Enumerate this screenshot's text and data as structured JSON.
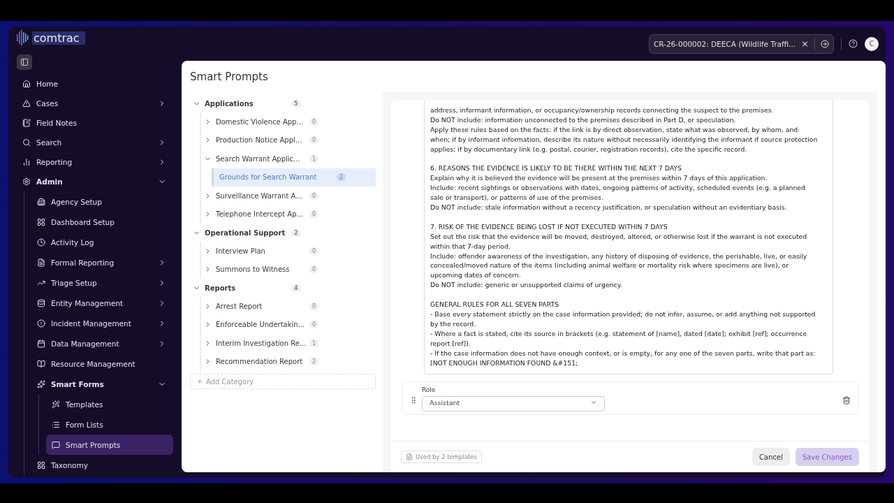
{
  "app": {
    "logo": "comtrac"
  },
  "case_tab": {
    "title": "CR-26-000002: DEECA (Wildlife Traffi...",
    "close": "×"
  },
  "avatar": {
    "initial": "C"
  },
  "nav": [
    {
      "label": "Home",
      "expandable": false,
      "expanded": false,
      "selected": false
    },
    {
      "label": "Cases",
      "expandable": true,
      "expanded": false,
      "selected": false
    },
    {
      "label": "Field Notes",
      "expandable": false,
      "expanded": false,
      "selected": false
    },
    {
      "label": "Search",
      "expandable": true,
      "expanded": false,
      "selected": false
    },
    {
      "label": "Reporting",
      "expandable": true,
      "expanded": false,
      "selected": false
    },
    {
      "label": "Admin",
      "expandable": true,
      "expanded": true,
      "selected": false,
      "children": [
        {
          "label": "Agency Setup",
          "expandable": false,
          "expanded": false,
          "selected": false
        },
        {
          "label": "Dashboard Setup",
          "expandable": false,
          "expanded": false,
          "selected": false
        },
        {
          "label": "Activity Log",
          "expandable": false,
          "expanded": false,
          "selected": false
        },
        {
          "label": "Formal Reporting",
          "expandable": true,
          "expanded": false,
          "selected": false
        },
        {
          "label": "Triage Setup",
          "expandable": true,
          "expanded": false,
          "selected": false
        },
        {
          "label": "Entity Management",
          "expandable": true,
          "expanded": false,
          "selected": false
        },
        {
          "label": "Incident Management",
          "expandable": true,
          "expanded": false,
          "selected": false
        },
        {
          "label": "Data Management",
          "expandable": true,
          "expanded": false,
          "selected": false
        },
        {
          "label": "Resource Management",
          "expandable": false,
          "expanded": false,
          "selected": false
        },
        {
          "label": "Smart Forms",
          "expandable": true,
          "expanded": true,
          "selected": false,
          "children": [
            {
              "label": "Templates",
              "expandable": false,
              "expanded": false,
              "selected": false
            },
            {
              "label": "Form Lists",
              "expandable": false,
              "expanded": false,
              "selected": false
            },
            {
              "label": "Smart Prompts",
              "expandable": false,
              "expanded": false,
              "selected": true
            }
          ]
        },
        {
          "label": "Taxonomy",
          "expandable": false,
          "expanded": false,
          "selected": false
        }
      ]
    }
  ],
  "page": {
    "title": "Smart Prompts"
  },
  "tree": [
    {
      "label": "Applications",
      "count": "5",
      "expanded": true,
      "selected": false,
      "children": [
        {
          "label": "Domestic Violence App...",
          "count": "0",
          "expanded": false,
          "selected": false
        },
        {
          "label": "Production Notice Appl...",
          "count": "0",
          "expanded": false,
          "selected": false
        },
        {
          "label": "Search Warrant Applic...",
          "count": "1",
          "expanded": true,
          "selected": false,
          "children": [
            {
              "label": "Grounds for Search Warrant",
              "count": "2",
              "expanded": false,
              "selected": true
            }
          ]
        },
        {
          "label": "Surveillance Warrant A...",
          "count": "0",
          "expanded": false,
          "selected": false
        },
        {
          "label": "Telephone Intercept Ap...",
          "count": "0",
          "expanded": false,
          "selected": false
        }
      ]
    },
    {
      "label": "Operational Support",
      "count": "2",
      "expanded": true,
      "selected": false,
      "children": [
        {
          "label": "Interview Plan",
          "count": "0",
          "expanded": false,
          "selected": false
        },
        {
          "label": "Summons to Witness",
          "count": "0",
          "expanded": false,
          "selected": false
        }
      ]
    },
    {
      "label": "Reports",
      "count": "4",
      "expanded": true,
      "selected": false,
      "children": [
        {
          "label": "Arrest Report",
          "count": "0",
          "expanded": false,
          "selected": false
        },
        {
          "label": "Enforceable Undertakin...",
          "count": "0",
          "expanded": false,
          "selected": false
        },
        {
          "label": "Interim Investigation Re...",
          "count": "1",
          "expanded": false,
          "selected": false
        },
        {
          "label": "Recommendation Report",
          "count": "2",
          "expanded": false,
          "selected": false
        }
      ]
    }
  ],
  "add_category": "Add Category",
  "prompt": {
    "sections": [
      {
        "lines": [
          "address, informant information, or occupancy/ownership records connecting the suspect to the premises.",
          "Do NOT include: information unconnected to the premises described in Part D, or speculation.",
          "Apply these rules based on the facts: if the link is by direct observation, state what was observed, by whom, and",
          "when; if by informant information, describe its nature without necessarily identifying the informant if source protection",
          "applies; if by documentary link (e.g. postal, courier, registration records), cite the specific record."
        ]
      },
      {
        "lines": [
          "6. REASONS THE EVIDENCE IS LIKELY TO BE THERE WITHIN THE NEXT 7 DAYS",
          "Explain why it is believed the evidence will be present at the premises within 7 days of this application.",
          "Include: recent sightings or observations with dates, ongoing patterns of activity, scheduled events (e.g. a planned",
          "sale or transport), or patterns of use of the premises.",
          "Do NOT include: stale information without a recency justification, or speculation without an evidentiary basis."
        ]
      },
      {
        "lines": [
          "7. RISK OF THE EVIDENCE BEING LOST IF NOT EXECUTED WITHIN 7 DAYS",
          "Set out the risk that the evidence will be moved, destroyed, altered, or otherwise lost if the warrant is not executed",
          "within that 7-day period.",
          "Include: offender awareness of the investigation, any history of disposing of evidence, the perishable, live, or easily",
          "concealed/moved nature of the items (including animal welfare or mortality risk where specimens are live), or",
          "upcoming dates of concern.",
          "Do NOT include: generic or unsupported claims of urgency."
        ]
      },
      {
        "lines": [
          "GENERAL RULES FOR ALL SEVEN PARTS",
          "- Base every statement strictly on the case information provided; do not infer, assume, or add anything not supported",
          "by the record.",
          "- Where a fact is stated, cite its source in brackets (e.g. statement of [name], dated [date]; exhibit [ref]; occurrence",
          "report [ref]).",
          "- If the case information does not have enough context, or is empty, for any one of the seven parts, write that part as:",
          "[NOT ENOUGH INFORMATION FOUND &#151;"
        ]
      }
    ]
  },
  "role": {
    "label": "Role",
    "value": "Assistant"
  },
  "footer": {
    "usage": "Used by 2 templates",
    "cancel": "Cancel",
    "save": "Save Changes"
  }
}
